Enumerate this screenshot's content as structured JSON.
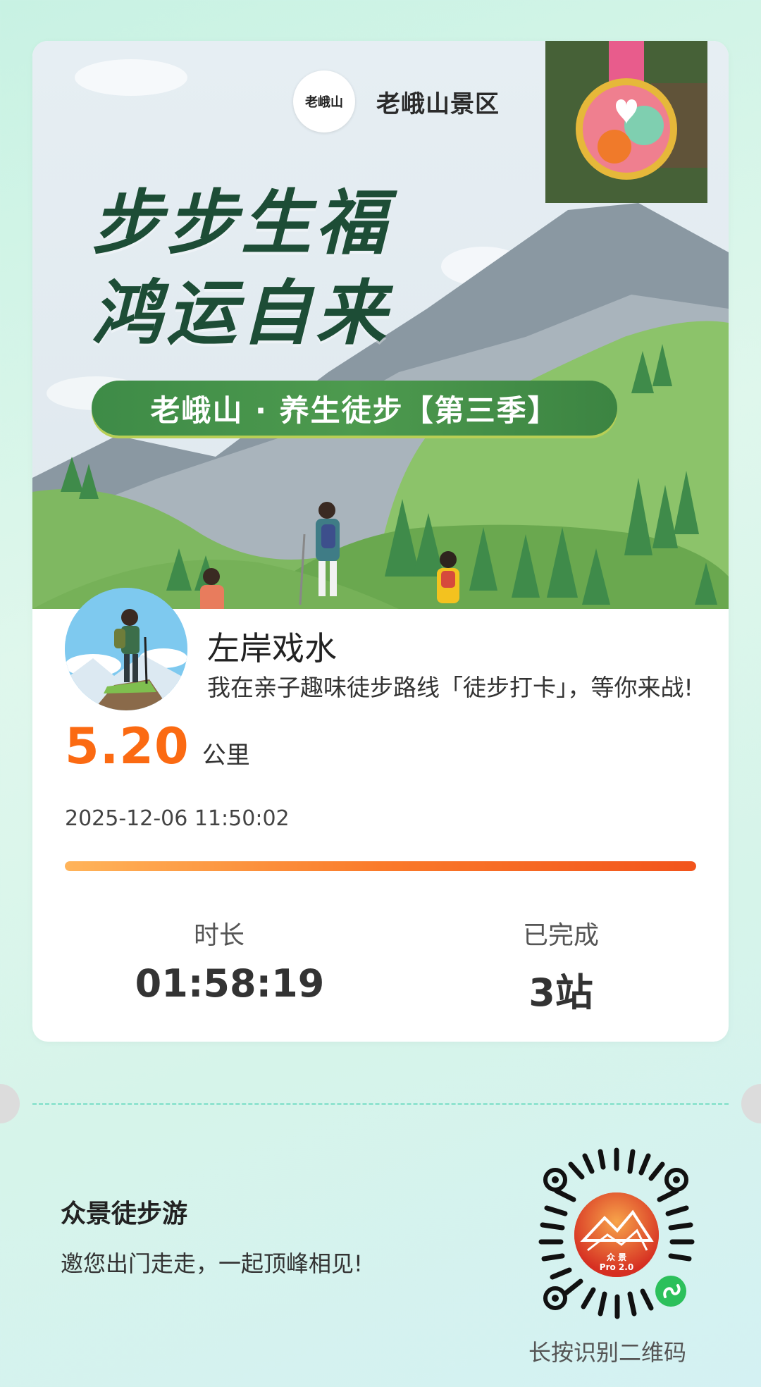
{
  "banner": {
    "scenic_name": "老峨山景区",
    "logo_text": "老峨山",
    "headline_line1": "步步生福",
    "headline_line2": "鸿运自来",
    "season_title": "老峨山 · 养生徒步【第三季】"
  },
  "user": {
    "name": "左岸戏水",
    "message": "我在亲子趣味徒步路线「徒步打卡」，等你来战!"
  },
  "distance": {
    "value": "5.20",
    "unit": "公里"
  },
  "datetime": "2025-12-06 11:50:02",
  "progress": {
    "fraction": 1.0
  },
  "stats": {
    "duration_label": "时长",
    "duration_value": "01:58:19",
    "completed_label": "已完成",
    "completed_value": "3站"
  },
  "footer": {
    "brand_title": "众景徒步游",
    "brand_subtitle": "邀您出门走走，一起顶峰相见!",
    "qr_center_text": "众 景",
    "qr_version": "Pro 2.0",
    "qr_caption": "长按识别二维码"
  },
  "icons": {
    "logo": "mountain-logo-icon",
    "medal": "medal-image",
    "avatar": "hiker-avatar",
    "qr": "mini-program-qr-code",
    "mini_program": "wechat-mini-program-icon"
  },
  "colors": {
    "accent_orange": "#fb6a12",
    "headline_green": "#1d4d36",
    "pill_green": "#3e8b47"
  }
}
